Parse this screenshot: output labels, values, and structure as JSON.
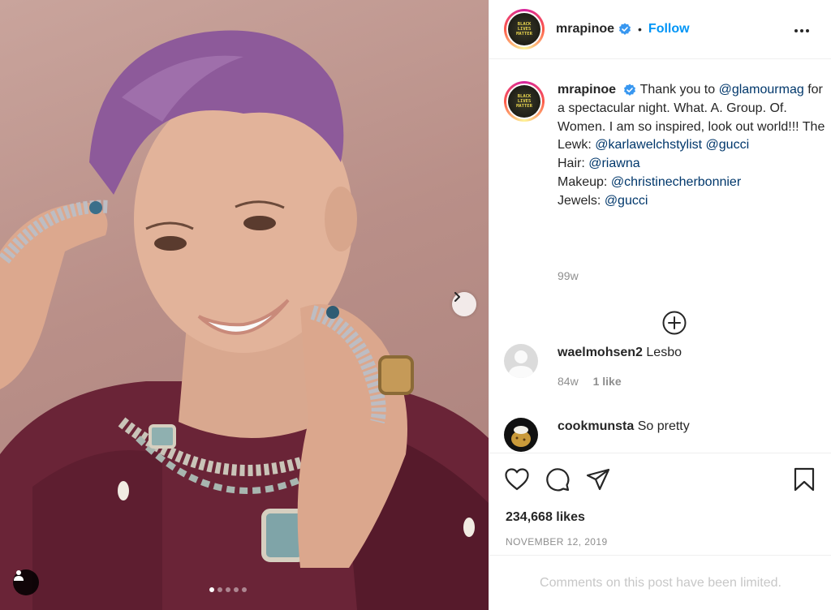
{
  "post": {
    "username": "mrapinoe",
    "follow_label": "Follow",
    "separator": "•",
    "avatar_text": [
      "BLACK",
      "LIVES",
      "MATTER"
    ],
    "caption": {
      "intro": "Thank you to",
      "mention_1": "@glamourmag",
      "line_1": "for a spectacular night. What. A. Group. Of. Women. I am so inspired, look out world!!! The Lewk:",
      "mention_2": "@karlawelchstylist",
      "mention_3": "@gucci",
      "hair_label": "Hair:",
      "mention_4": "@riawna",
      "makeup_label": "Makeup:",
      "mention_5": "@christinecherbonnier",
      "jewels_label": "Jewels:",
      "mention_6": "@gucci"
    },
    "caption_time": "99w",
    "comments": [
      {
        "username": "waelmohsen2",
        "text": "Lesbo",
        "time": "84w",
        "likes": "1 like"
      },
      {
        "username": "cookmunsta",
        "text": "So pretty"
      }
    ],
    "likes": "234,668 likes",
    "date": "NOVEMBER 12, 2019",
    "comments_limited": "Comments on this post have been limited."
  },
  "carousel": {
    "total": 5,
    "active": 0
  },
  "colors": {
    "link": "#00376b",
    "follow": "#0095f6",
    "verified": "#3897f0",
    "muted": "#8e8e8e"
  },
  "icons": [
    "verified-badge-icon",
    "more-options-icon",
    "add-comment-icon",
    "heart-icon",
    "comment-icon",
    "share-icon",
    "bookmark-icon",
    "chevron-right-icon",
    "user-tag-icon"
  ]
}
